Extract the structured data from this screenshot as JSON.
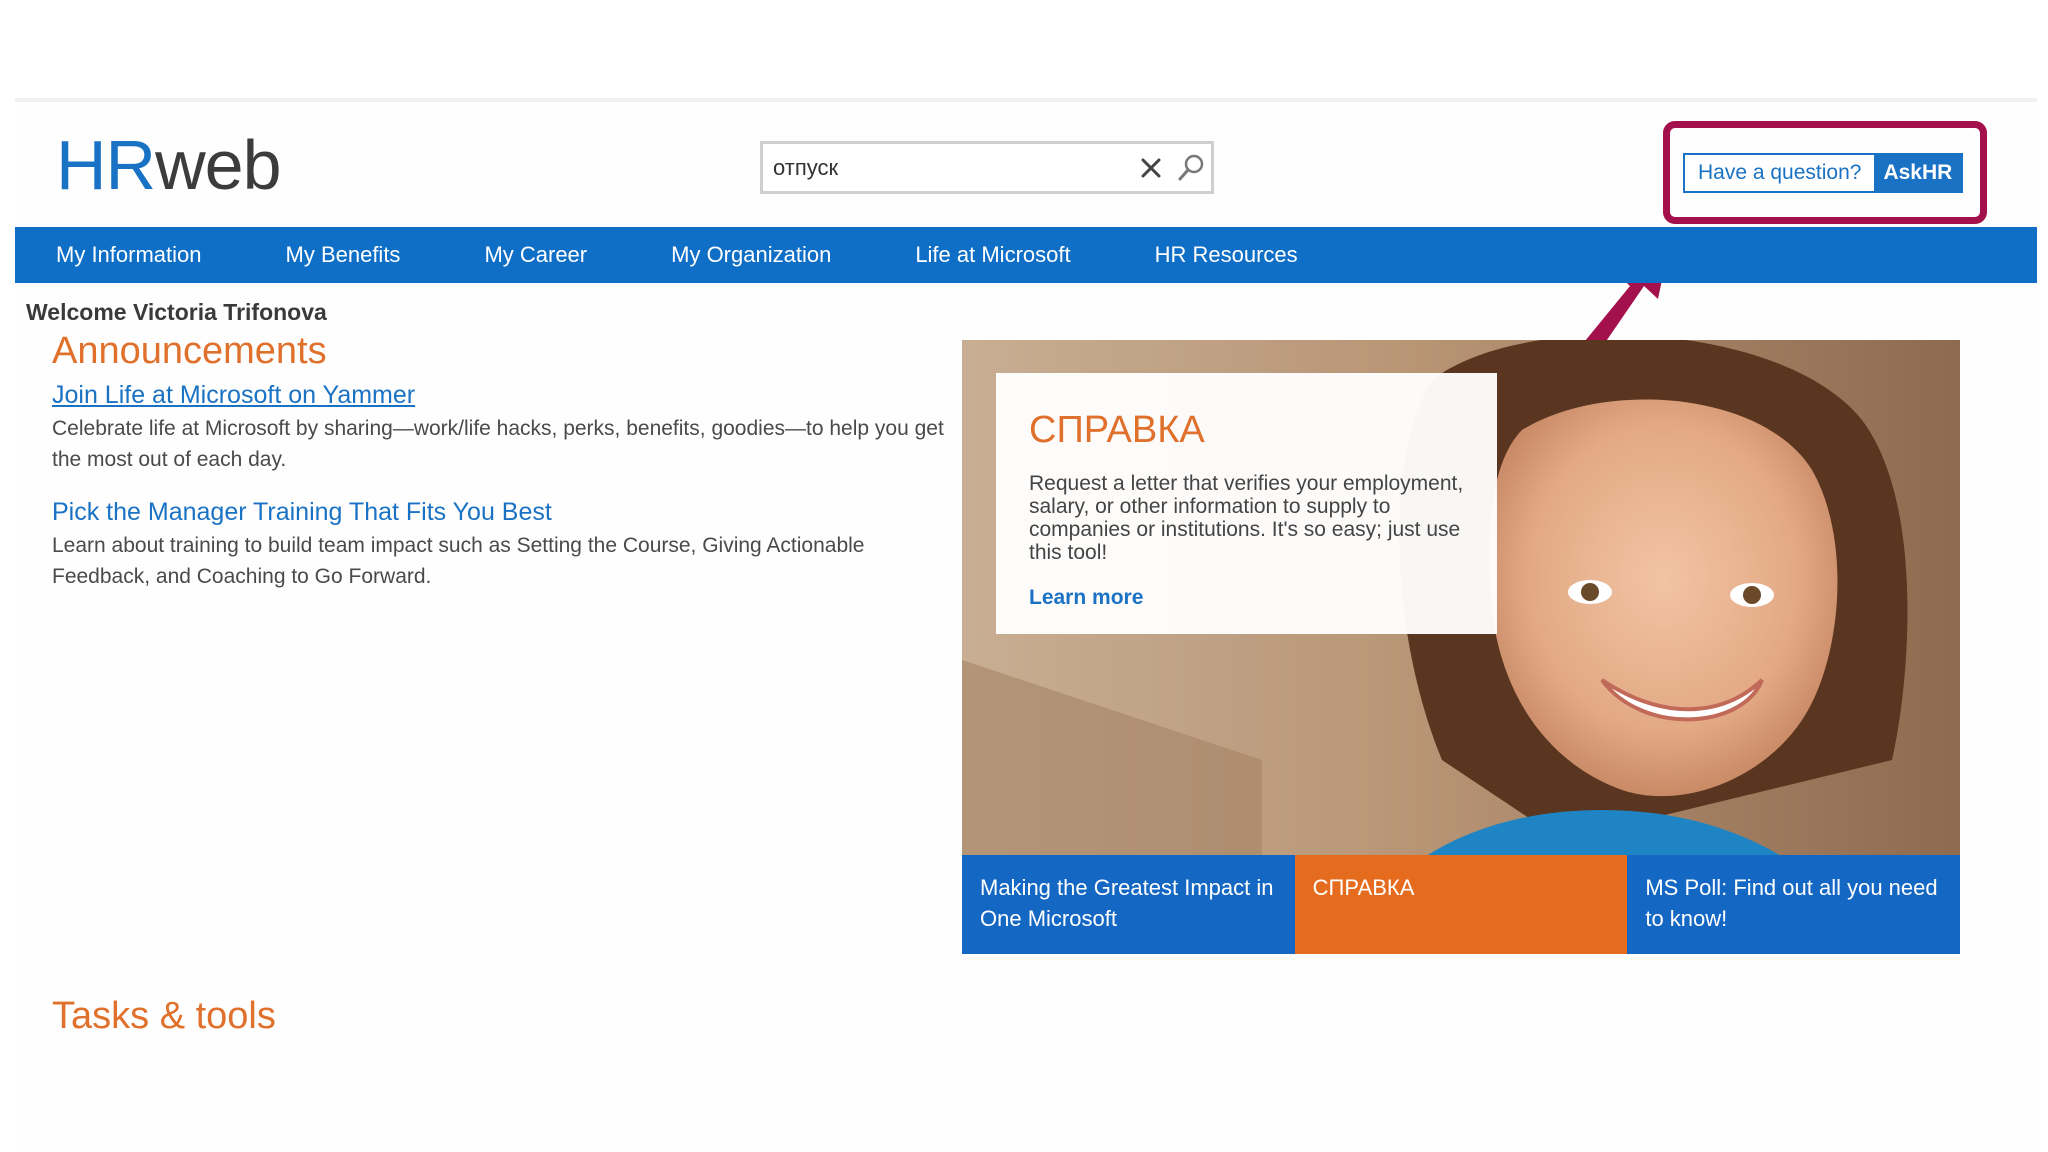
{
  "header": {
    "logo_hr": "HR",
    "logo_web": "web",
    "search": {
      "value": "отпуск",
      "placeholder": ""
    },
    "ask": {
      "question_label": "Have a question?",
      "askhr_label": "AskHR"
    }
  },
  "nav": {
    "items": [
      {
        "label": "My Information"
      },
      {
        "label": "My Benefits"
      },
      {
        "label": "My Career"
      },
      {
        "label": "My Organization"
      },
      {
        "label": "Life at Microsoft"
      },
      {
        "label": "HR Resources"
      }
    ]
  },
  "welcome": "Welcome Victoria Trifonova",
  "announcements": {
    "title": "Announcements",
    "items": [
      {
        "title": "Join Life at Microsoft on Yammer",
        "text": "Celebrate life at Microsoft by sharing—work/life hacks, perks, benefits, goodies—to help you get the most out of each day."
      },
      {
        "title": "Pick the Manager Training That Fits You Best",
        "text": "Learn about training to build team impact such as Setting the Course, Giving Actionable Feedback, and Coaching to Go Forward."
      }
    ]
  },
  "hero": {
    "card": {
      "title": "СПРАВКА",
      "text": "Request a letter that verifies your employment, salary, or other information to supply to companies or institutions. It's so easy; just use this tool!",
      "link": "Learn more"
    },
    "tiles": [
      {
        "label": "Making the Greatest Impact in One Microsoft"
      },
      {
        "label": "СПРАВКА"
      },
      {
        "label": "MS Poll: Find out all you need to know!"
      }
    ]
  },
  "tasks": {
    "title": "Tasks & tools"
  },
  "colors": {
    "brand_blue": "#0f6fc6",
    "accent_orange": "#e0712d",
    "highlight": "#a3104b"
  }
}
